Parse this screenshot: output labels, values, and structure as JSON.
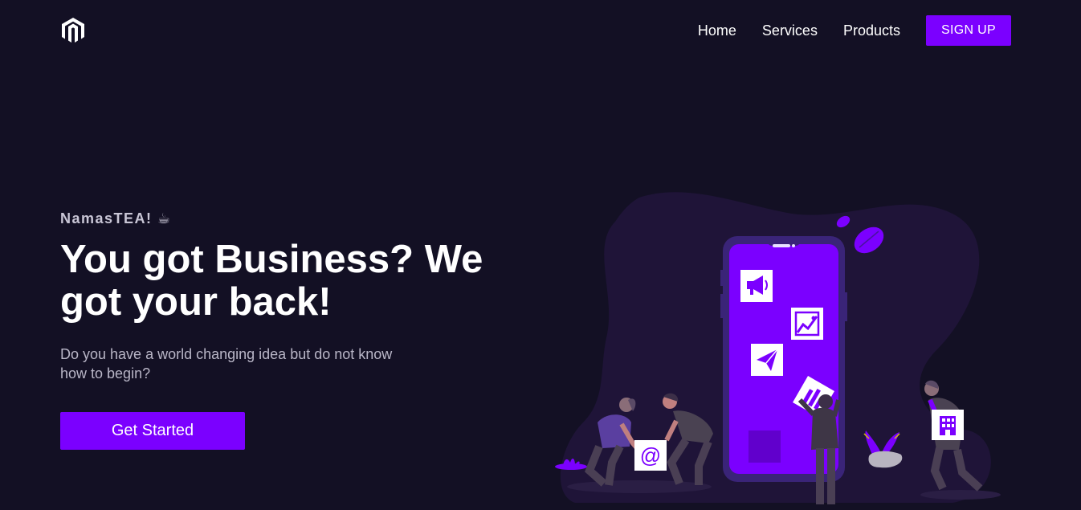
{
  "nav": {
    "logo_icon": "magento-logo-icon",
    "links": [
      "Home",
      "Services",
      "Products"
    ],
    "signup_label": "SIGN UP"
  },
  "hero": {
    "tagline": "NamasTEA! ☕",
    "headline": "You got Business? We got your back!",
    "subtext": "Do you have a world changing idea but do not know how to begin?",
    "cta_label": "Get Started"
  },
  "illustration": {
    "description_icons": [
      "megaphone-icon",
      "chart-icon",
      "paper-plane-icon",
      "at-sign-icon",
      "building-icon"
    ]
  },
  "colors": {
    "background": "#131024",
    "accent": "#7b00ff",
    "blob": "#1f1438"
  }
}
